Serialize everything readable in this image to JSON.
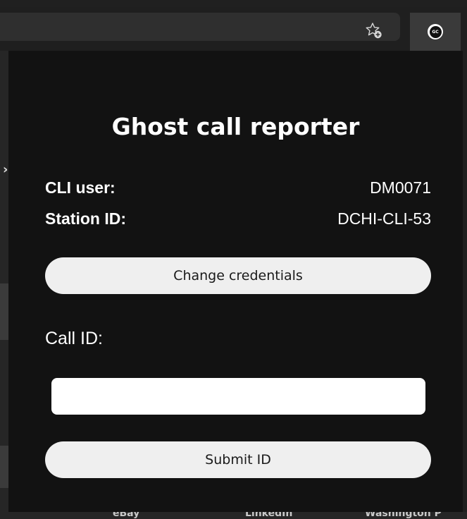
{
  "browser": {
    "bookmarks": [
      "eBay",
      "LinkedIn",
      "Washington P"
    ]
  },
  "icons": {
    "star": "add-to-favorites-icon",
    "extension": "ghost-call-extension-icon"
  },
  "extension": {
    "logo_text": "GC"
  },
  "popup": {
    "title": "Ghost call reporter",
    "cli_user_label": "CLI user:",
    "cli_user_value": "DM0071",
    "station_label": "Station ID:",
    "station_value": "DCHI-CLI-53",
    "change_credentials_label": "Change credentials",
    "call_id_label": "Call ID:",
    "call_id_value": "",
    "submit_label": "Submit ID"
  }
}
